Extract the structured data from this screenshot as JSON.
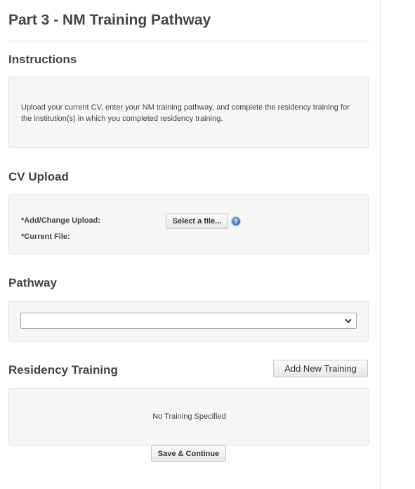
{
  "page": {
    "title": "Part 3 - NM Training Pathway"
  },
  "instructions": {
    "heading": "Instructions",
    "text": "Upload your current CV, enter your NM training pathway, and complete the residency training for the institution(s) in which you completed residency training."
  },
  "cv_upload": {
    "heading": "CV Upload",
    "add_change_label": "*Add/Change Upload:",
    "select_file_label": "Select a file...",
    "help_icon_glyph": "?",
    "current_file_label": "*Current File:"
  },
  "pathway": {
    "heading": "Pathway",
    "selected_value": ""
  },
  "residency_training": {
    "heading": "Residency Training",
    "add_button_label": "Add New Training",
    "empty_message": "No Training Specified"
  },
  "footer": {
    "save_continue_label": "Save & Continue"
  },
  "icons": {
    "help": "help-icon",
    "dropdown": "chevron-down-icon"
  },
  "colors": {
    "text": "#444444",
    "well_background": "#f6f6f6",
    "help_icon": "#2f62ad"
  }
}
